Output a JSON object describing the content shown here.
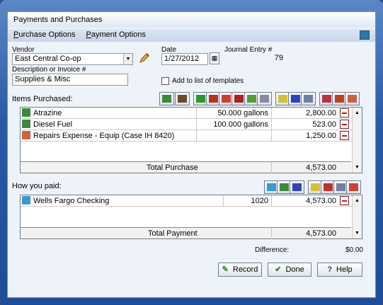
{
  "window": {
    "title": "Payments and Purchases"
  },
  "menu": {
    "items": [
      {
        "pre": "P",
        "rest": "urchase Options"
      },
      {
        "pre": "P",
        "rest": "ayment Options"
      }
    ]
  },
  "header": {
    "vendor_label": "Vendor",
    "vendor_value": "East Central Co-op",
    "date_label": "Date",
    "date_value": "1/27/2012",
    "journal_label": "Journal Entry #",
    "journal_value": "79",
    "desc_label": "Description or Invoice #",
    "desc_value": "Supplies & Misc",
    "template_label": "Add to list of templates"
  },
  "items": {
    "label": "Items Purchased:",
    "rows": [
      {
        "name": "Atrazine",
        "qty": "50.000  gallons",
        "amount": "2,800.00"
      },
      {
        "name": "Diesel Fuel",
        "qty": "100.000  gallons",
        "amount": "523.00"
      },
      {
        "name": "Repairs Expense - Equip (Case IH 8420)",
        "qty": "",
        "amount": "1,250.00"
      }
    ],
    "total_label": "Total Purchase",
    "total_value": "4,573.00"
  },
  "paid": {
    "label": "How you paid:",
    "rows": [
      {
        "name": "Wells Fargo Checking",
        "ref": "1020",
        "amount": "4,573.00"
      }
    ],
    "total_label": "Total Payment",
    "total_value": "4,573.00"
  },
  "difference": {
    "label": "Difference:",
    "value": "$0.00"
  },
  "buttons": {
    "record": "Record",
    "done": "Done",
    "help": "Help"
  },
  "colors": {
    "frame": "#1d4d97",
    "minus_red": "#c01818"
  }
}
